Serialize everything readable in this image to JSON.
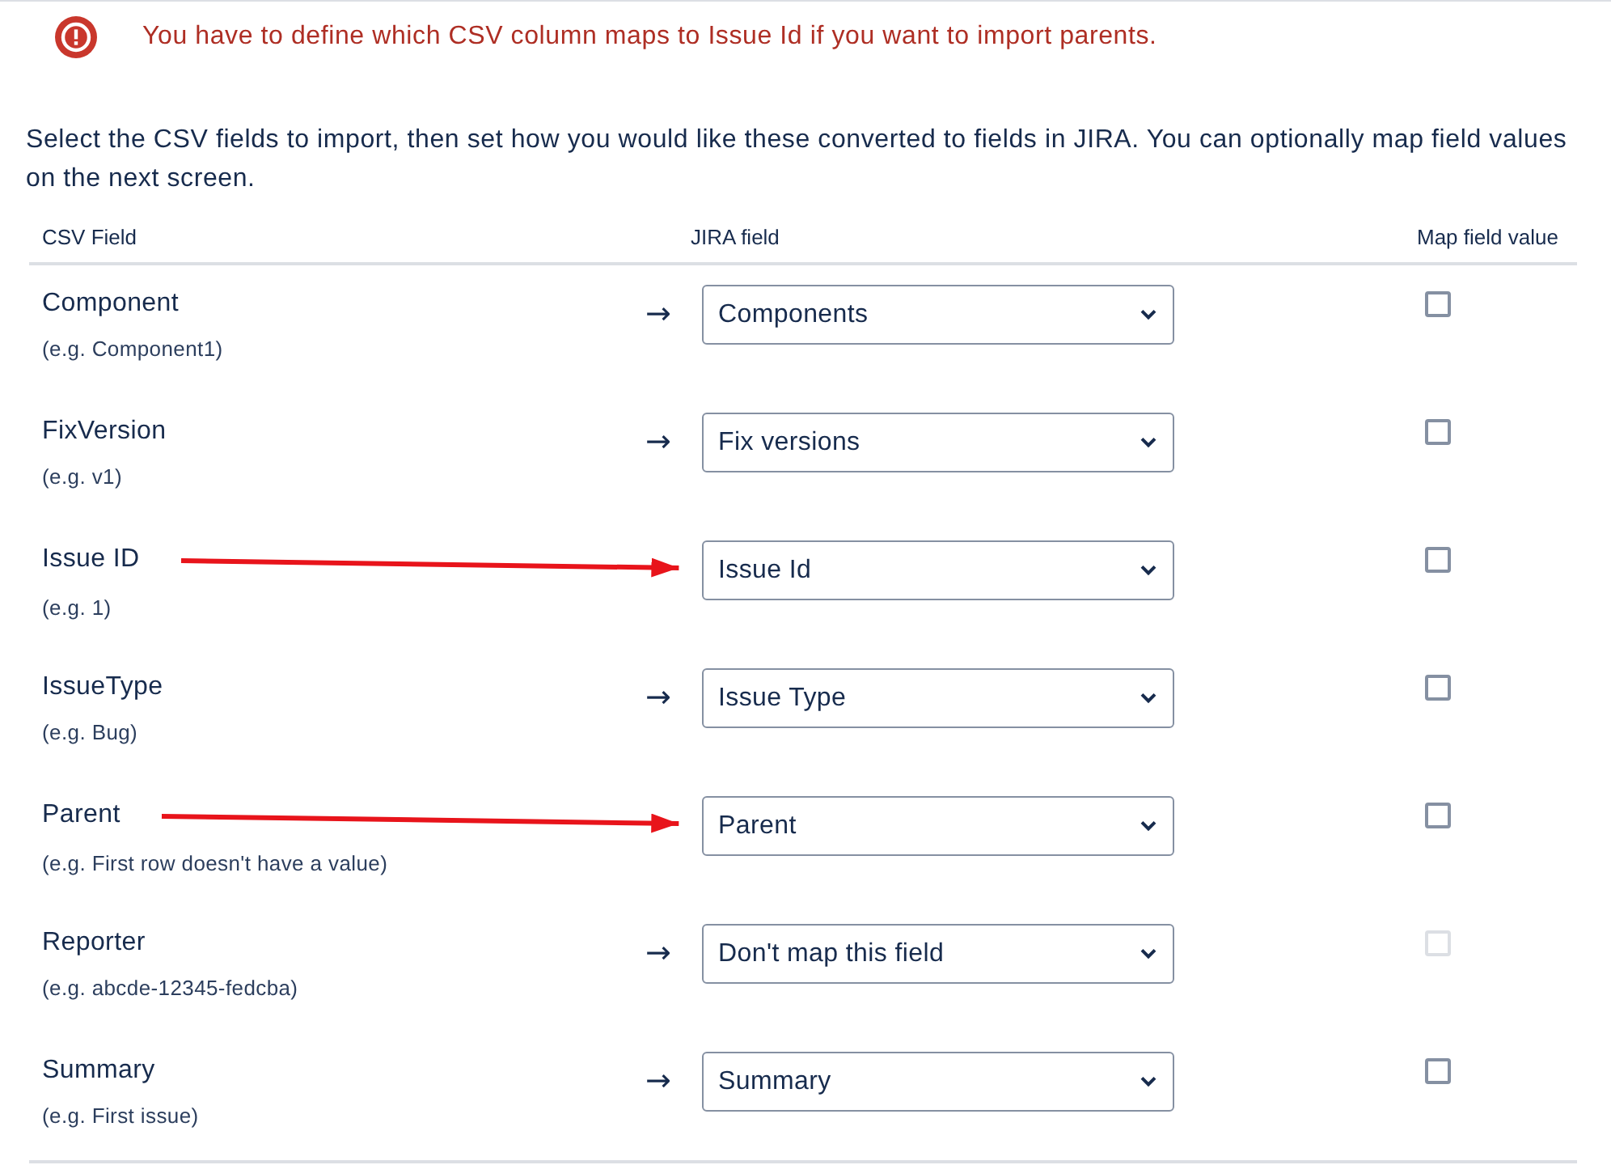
{
  "alert": {
    "kind": "error",
    "message": "You have to define which CSV column maps to Issue Id if you want to import parents."
  },
  "intro": "Select the CSV fields to import, then set how you would like these converted to fields in JIRA. You can optionally map field values on the next screen.",
  "table": {
    "columns": [
      "CSV Field",
      "JIRA field",
      "Map field value"
    ],
    "rows": [
      {
        "csv_field": "Component",
        "example": "(e.g. Component1)",
        "arrow": "→",
        "highlighted": false,
        "jira_field": "Components",
        "map_value": {
          "checked": false,
          "disabled": false
        }
      },
      {
        "csv_field": "FixVersion",
        "example": "(e.g. v1)",
        "arrow": "→",
        "highlighted": false,
        "jira_field": "Fix versions",
        "map_value": {
          "checked": false,
          "disabled": false
        }
      },
      {
        "csv_field": "Issue ID",
        "example": "(e.g. 1)",
        "highlighted": true,
        "jira_field": "Issue Id",
        "map_value": {
          "checked": false,
          "disabled": false
        }
      },
      {
        "csv_field": "IssueType",
        "example": "(e.g. Bug)",
        "arrow": "→",
        "highlighted": false,
        "jira_field": "Issue Type",
        "map_value": {
          "checked": false,
          "disabled": false
        }
      },
      {
        "csv_field": "Parent",
        "example": "(e.g. First row doesn't have a value)",
        "highlighted": true,
        "jira_field": "Parent",
        "map_value": {
          "checked": false,
          "disabled": false
        }
      },
      {
        "csv_field": "Reporter",
        "example": "(e.g. abcde-12345-fedcba)",
        "arrow": "→",
        "highlighted": false,
        "jira_field": "Don't map this field",
        "map_value": {
          "checked": false,
          "disabled": true
        }
      },
      {
        "csv_field": "Summary",
        "example": "(e.g. First issue)",
        "arrow": "→",
        "highlighted": false,
        "jira_field": "Summary",
        "map_value": {
          "checked": false,
          "disabled": false
        }
      }
    ]
  }
}
